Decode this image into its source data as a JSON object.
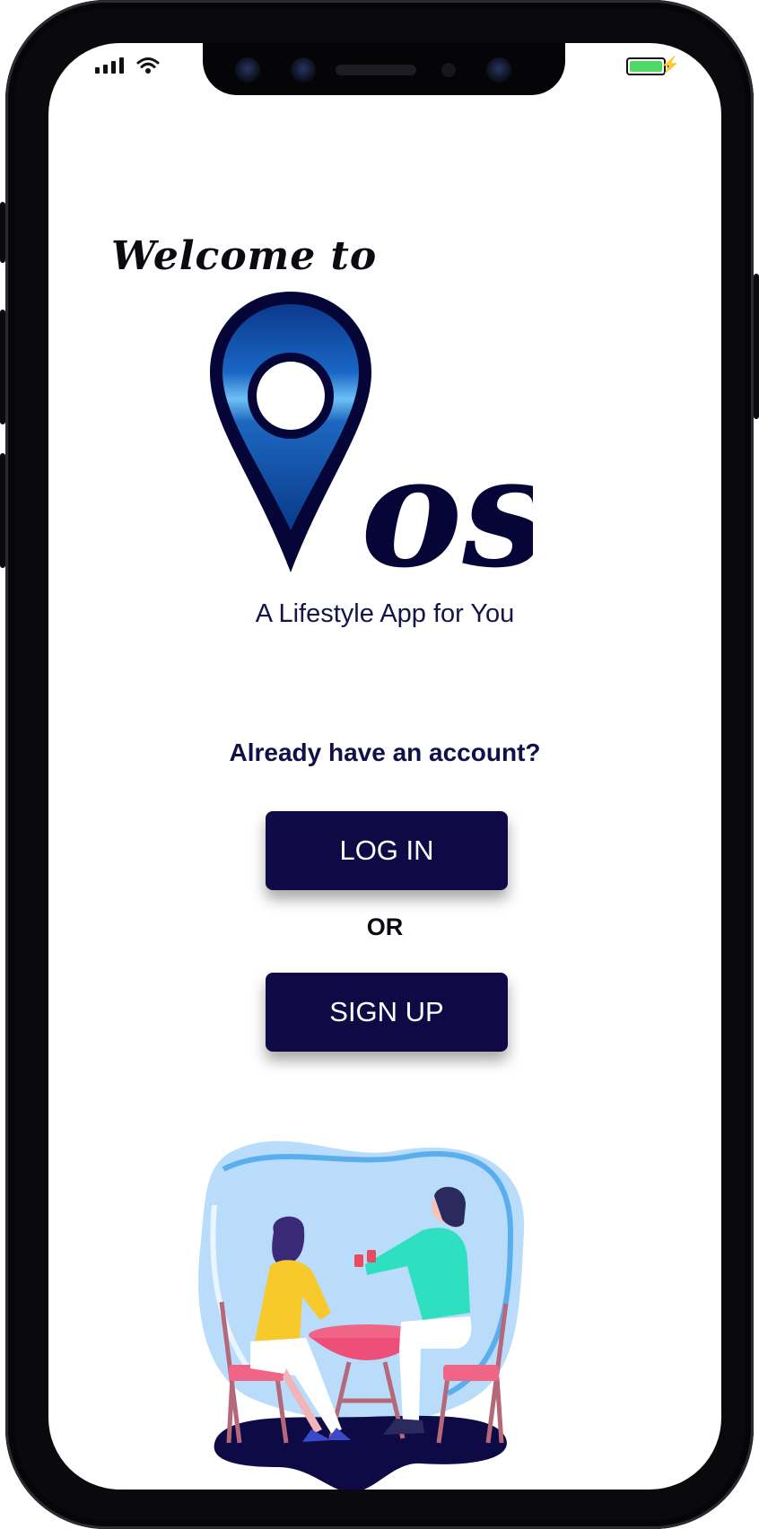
{
  "welcome_text": "Welcome to",
  "logo": {
    "text": "os",
    "pin_colors": {
      "outer": "#050537",
      "mid": "#1a5fb4",
      "light": "#3b9be8"
    }
  },
  "tagline": "A Lifestyle App for You",
  "question": "Already have an account?",
  "login_label": "LOG IN",
  "or_label": "OR",
  "signup_label": "SIGN UP",
  "colors": {
    "button_bg": "#0f0a45",
    "text_dark": "#11114a",
    "battery": "#4cd964"
  },
  "icons": [
    "signal-icon",
    "wifi-icon",
    "battery-icon",
    "charging-bolt-icon"
  ]
}
